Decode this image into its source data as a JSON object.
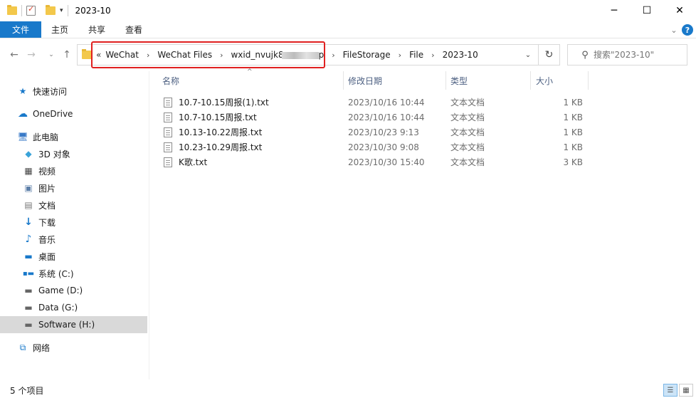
{
  "window": {
    "title": "2023-10",
    "minimize_glyph": "─",
    "maximize_glyph": "☐",
    "close_glyph": "✕"
  },
  "ribbon": {
    "file_tab": "文件",
    "tabs": [
      "主页",
      "共享",
      "查看"
    ],
    "accent": "#1979ca",
    "help_glyph": "?"
  },
  "address": {
    "overflow": "«",
    "crumbs": [
      "WeChat",
      "WeChat Files",
      "wxid_nvujk8",
      "FileStorage",
      "File",
      "2023-10"
    ],
    "crumb_suffix": "p"
  },
  "search": {
    "placeholder": "搜索\"2023-10\""
  },
  "sidebar": {
    "items": [
      {
        "label": "快速访问",
        "icon": "star-icon"
      },
      {
        "label": "OneDrive",
        "icon": "cloud-icon"
      },
      {
        "label": "此电脑",
        "icon": "computer-icon"
      },
      {
        "label": "3D 对象",
        "icon": "cube-icon"
      },
      {
        "label": "视频",
        "icon": "video-icon"
      },
      {
        "label": "图片",
        "icon": "picture-icon"
      },
      {
        "label": "文档",
        "icon": "document-icon"
      },
      {
        "label": "下载",
        "icon": "download-icon"
      },
      {
        "label": "音乐",
        "icon": "music-icon"
      },
      {
        "label": "桌面",
        "icon": "desktop-icon"
      },
      {
        "label": "系统 (C:)",
        "icon": "windows-drive-icon"
      },
      {
        "label": "Game (D:)",
        "icon": "drive-icon"
      },
      {
        "label": "Data (G:)",
        "icon": "drive-icon"
      },
      {
        "label": "Software (H:)",
        "icon": "drive-icon",
        "selected": true
      },
      {
        "label": "网络",
        "icon": "network-icon"
      }
    ]
  },
  "columns": {
    "name": "名称",
    "modified": "修改日期",
    "type": "类型",
    "size": "大小"
  },
  "files": [
    {
      "name": "10.7-10.15周报(1).txt",
      "modified": "2023/10/16 10:44",
      "type": "文本文档",
      "size": "1 KB"
    },
    {
      "name": "10.7-10.15周报.txt",
      "modified": "2023/10/16 10:44",
      "type": "文本文档",
      "size": "1 KB"
    },
    {
      "name": "10.13-10.22周报.txt",
      "modified": "2023/10/23 9:13",
      "type": "文本文档",
      "size": "1 KB"
    },
    {
      "name": "10.23-10.29周报.txt",
      "modified": "2023/10/30 9:08",
      "type": "文本文档",
      "size": "1 KB"
    },
    {
      "name": "K歌.txt",
      "modified": "2023/10/30 15:40",
      "type": "文本文档",
      "size": "3 KB"
    }
  ],
  "status": {
    "item_count": "5 个项目"
  },
  "highlight_color": "#e02020"
}
